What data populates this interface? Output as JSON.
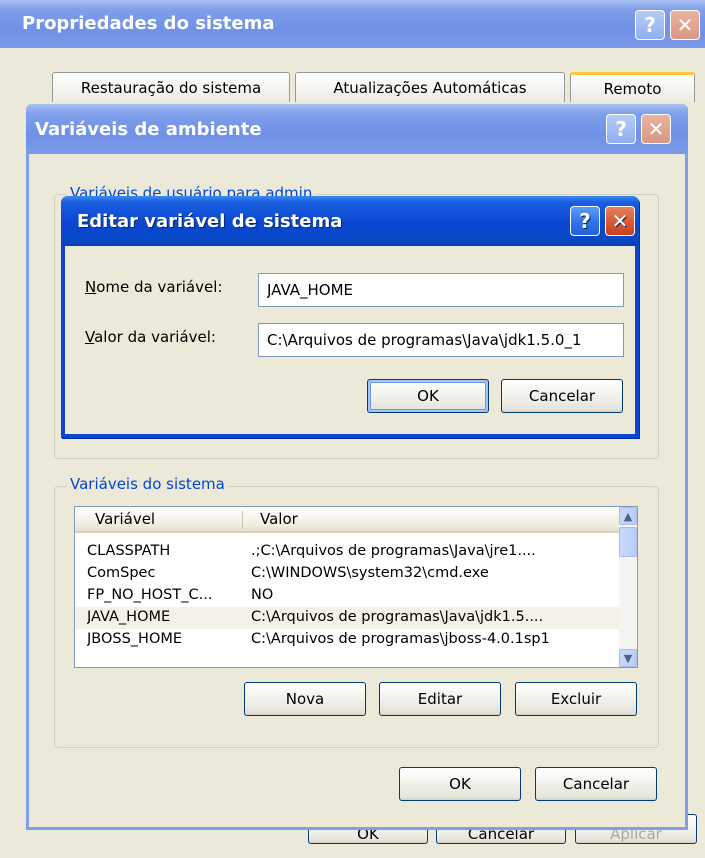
{
  "system_properties": {
    "title": "Propriedades do sistema",
    "help_icon": "?",
    "close_icon": "✕",
    "tabs": [
      {
        "label": "Restauração do sistema"
      },
      {
        "label": "Atualizações Automáticas"
      },
      {
        "label": "Remoto"
      }
    ],
    "footer_buttons": {
      "ok": "OK",
      "cancel": "Cancelar",
      "apply": "Aplicar"
    }
  },
  "env_vars": {
    "title": "Variáveis de ambiente",
    "help_icon": "?",
    "close_icon": "✕",
    "user_group_label": "Variáveis de usuário para admin",
    "system_group_label": "Variáveis do sistema",
    "columns": [
      "Variável",
      "Valor"
    ],
    "rows": [
      {
        "name": "CLASSPATH",
        "value": ".;C:\\Arquivos de programas\\Java\\jre1...."
      },
      {
        "name": "ComSpec",
        "value": "C:\\WINDOWS\\system32\\cmd.exe"
      },
      {
        "name": "FP_NO_HOST_C...",
        "value": "NO"
      },
      {
        "name": "JAVA_HOME",
        "value": "C:\\Arquivos de programas\\Java\\jdk1.5...."
      },
      {
        "name": "JBOSS_HOME",
        "value": "C:\\Arquivos de programas\\jboss-4.0.1sp1"
      }
    ],
    "selected_row": "JAVA_HOME",
    "buttons": {
      "new": "Nova",
      "edit": "Editar",
      "delete": "Excluir"
    },
    "footer_buttons": {
      "ok": "OK",
      "cancel": "Cancelar"
    }
  },
  "edit_dialog": {
    "title": "Editar variável de sistema",
    "help_icon": "?",
    "close_icon": "✕",
    "name_label_mnemonic": "N",
    "name_label_rest": "ome da variável:",
    "name_value": "JAVA_HOME",
    "value_label_mnemonic": "V",
    "value_label_rest": "alor da variável:",
    "value_value": "C:\\Arquivos de programas\\Java\\jdk1.5.0_1",
    "ok": "OK",
    "cancel": "Cancelar"
  },
  "colors": {
    "title_active": "#0a46d0",
    "title_inactive": "#7f9fea",
    "window_bg": "#ece9d8",
    "group_label": "#0046d5",
    "close_button": "#d85a34"
  }
}
